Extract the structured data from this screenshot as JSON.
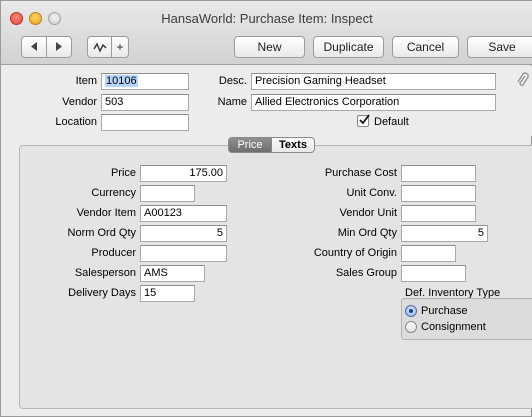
{
  "window": {
    "title": "HansaWorld: Purchase Item: Inspect"
  },
  "toolbar": {
    "new_label": "New",
    "duplicate_label": "Duplicate",
    "cancel_label": "Cancel",
    "save_label": "Save",
    "plus_label": "+"
  },
  "header": {
    "item_label": "Item",
    "item_value": "10106",
    "vendor_label": "Vendor",
    "vendor_value": "503",
    "location_label": "Location",
    "location_value": "",
    "desc_label": "Desc.",
    "desc_value": "Precision Gaming Headset",
    "name_label": "Name",
    "name_value": "Allied Electronics Corporation",
    "default_label": "Default",
    "default_checked": true
  },
  "tabs": [
    {
      "label": "Price",
      "active": true
    },
    {
      "label": "Texts",
      "active": false
    }
  ],
  "price": {
    "left": [
      {
        "label": "Price",
        "value": "175.00"
      },
      {
        "label": "Currency",
        "value": ""
      },
      {
        "label": "Vendor Item",
        "value": "A00123"
      },
      {
        "label": "Norm Ord Qty",
        "value": "5"
      },
      {
        "label": "Producer",
        "value": ""
      },
      {
        "label": "Salesperson",
        "value": "AMS"
      },
      {
        "label": "Delivery Days",
        "value": "15"
      }
    ],
    "right": [
      {
        "label": "Purchase Cost",
        "value": ""
      },
      {
        "label": "Unit Conv.",
        "value": ""
      },
      {
        "label": "Vendor Unit",
        "value": ""
      },
      {
        "label": "Min Ord Qty",
        "value": "5"
      },
      {
        "label": "Country of Origin",
        "value": ""
      },
      {
        "label": "Sales Group",
        "value": ""
      }
    ],
    "inventory_type_label": "Def. Inventory Type",
    "inventory_options": [
      {
        "label": "Purchase",
        "selected": true
      },
      {
        "label": "Consignment",
        "selected": false
      }
    ]
  },
  "icons": {
    "close": "traffic-close-icon",
    "minimize": "traffic-minimize-icon",
    "zoom": "traffic-zoom-icon",
    "prev": "triangle-left-icon",
    "next": "triangle-right-icon",
    "activity": "wave-icon",
    "attachment": "paperclip-icon"
  },
  "colors": {
    "selection": "#b5d5ff",
    "active_tab": "#7d7d7d"
  }
}
